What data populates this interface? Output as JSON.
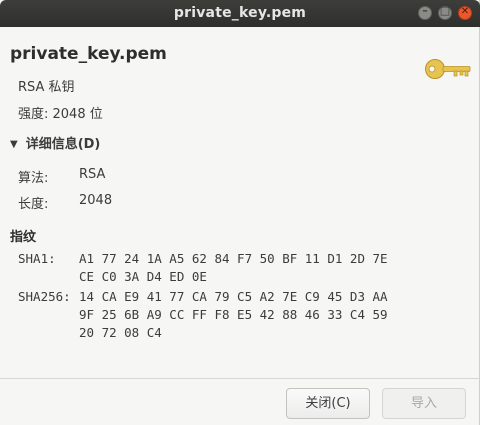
{
  "window": {
    "title": "private_key.pem",
    "minimize_glyph": "–",
    "maximize_glyph": "□",
    "close_glyph": "✕"
  },
  "header": {
    "file_title": "private_key.pem",
    "subtitle": "RSA 私钥",
    "strength": "强度: 2048 位",
    "icon": "key-icon"
  },
  "details": {
    "expander_label": "详细信息(D)",
    "expanded": true,
    "algorithm_label": "算法:",
    "algorithm_value": "RSA",
    "length_label": "长度:",
    "length_value": "2048"
  },
  "fingerprints": {
    "section_title": "指纹",
    "sha1_label": "SHA1:",
    "sha1_value": "A1 77 24 1A A5 62 84 F7 50 BF 11 D1 2D 7E\nCE C0 3A D4 ED 0E",
    "sha256_label": "SHA256:",
    "sha256_value": "14 CA E9 41 77 CA 79 C5 A2 7E C9 45 D3 AA\n9F 25 6B A9 CC FF F8 E5 42 88 46 33 C4 59\n20 72 08 C4"
  },
  "buttons": {
    "close_label": "关闭(C)",
    "import_label": "导入"
  },
  "colors": {
    "titlebar": "#2f2f2c",
    "close_button": "#e9572d",
    "key_gold": "#e7c34f"
  }
}
